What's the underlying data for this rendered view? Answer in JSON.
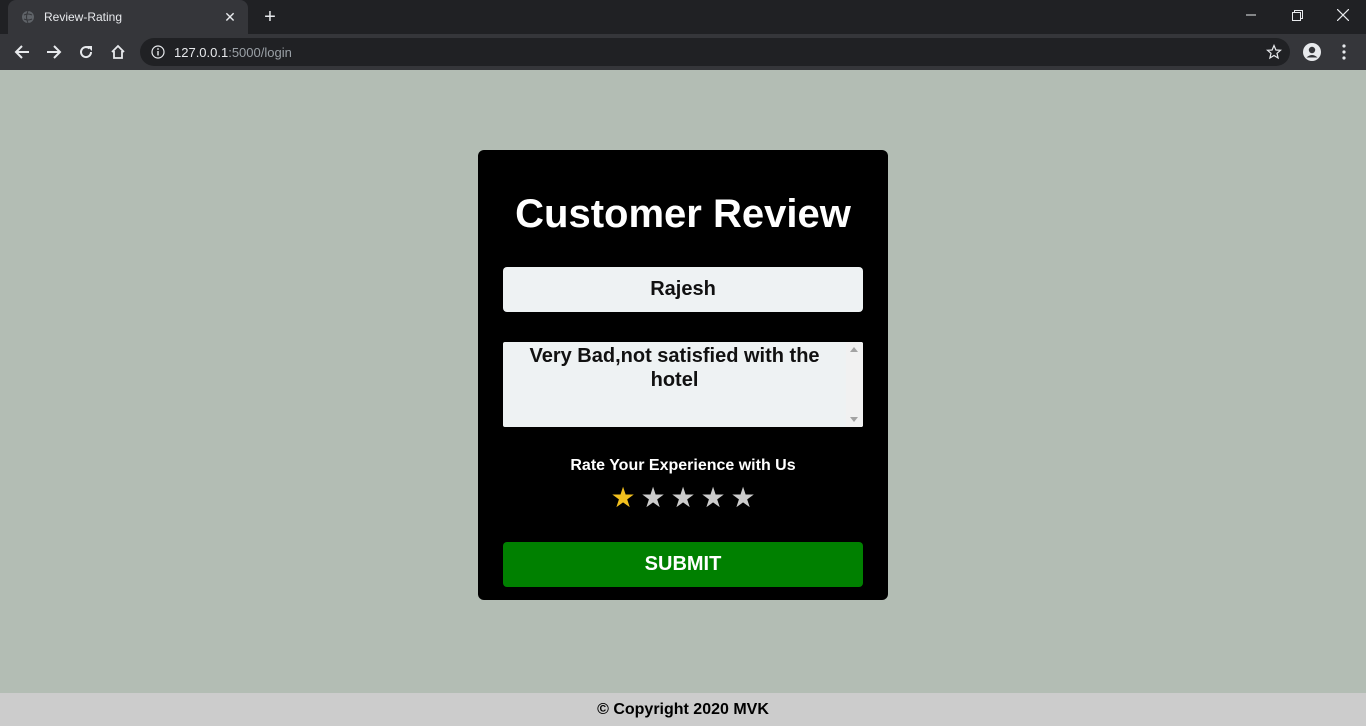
{
  "browser": {
    "tab_title": "Review-Rating",
    "url_host": "127.0.0.1",
    "url_path": ":5000/login"
  },
  "form": {
    "title": "Customer Review",
    "name_value": "Rajesh",
    "review_text": "Very Bad,not satisfied with the hotel",
    "rate_label": "Rate Your Experience with Us",
    "rating": 1,
    "max_rating": 5,
    "submit_label": "SUBMIT"
  },
  "colors": {
    "star_active": "#f2c01e",
    "star_inactive": "#cccccc",
    "submit": "#008000",
    "page_bg": "#b3bdb4"
  },
  "footer": {
    "text": "© Copyright 2020 MVK"
  }
}
